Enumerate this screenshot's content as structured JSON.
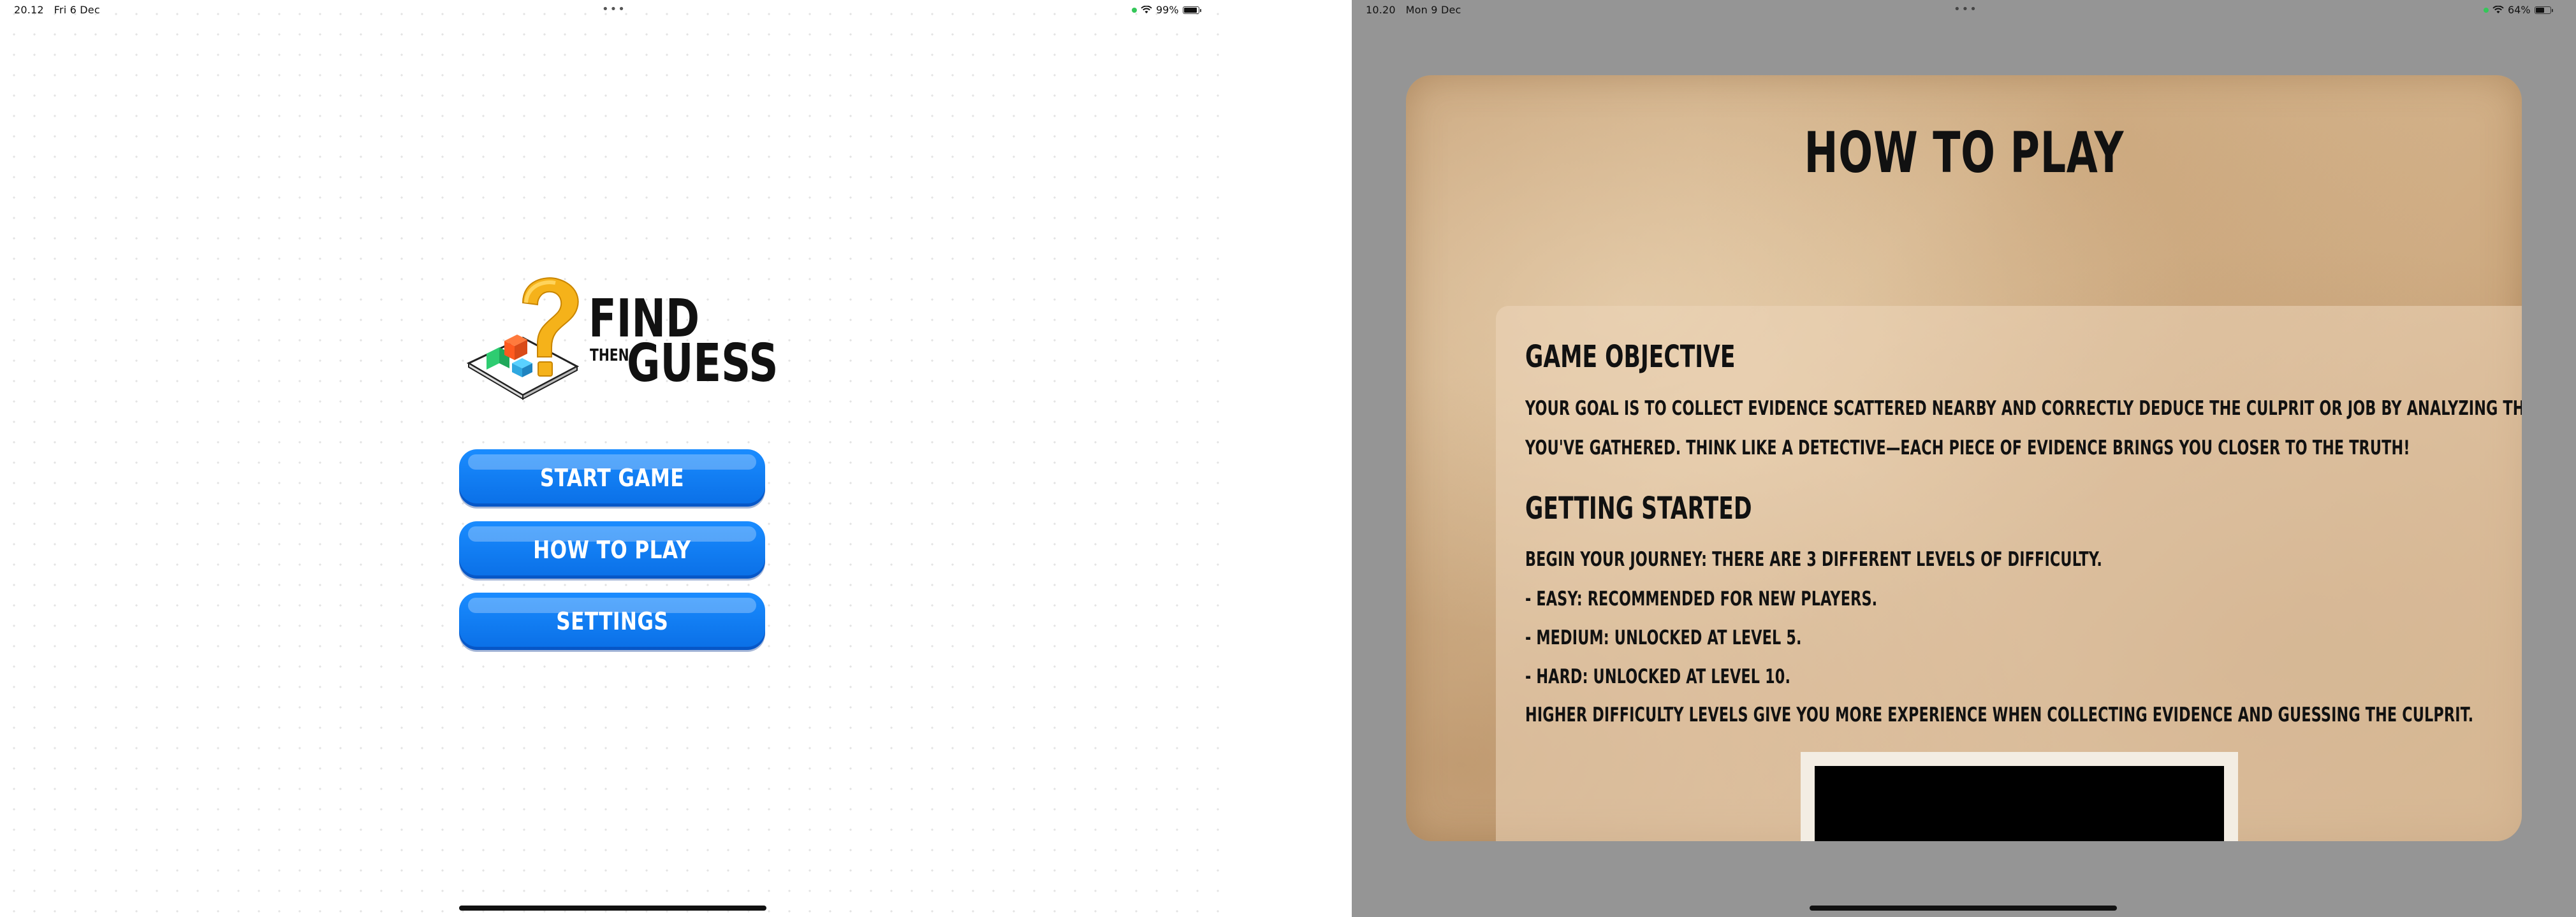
{
  "left_screen": {
    "status_bar": {
      "time": "20.12",
      "date": "Fri 6 Dec",
      "dots": "•••",
      "battery": "99%",
      "battery_level": 0.99
    },
    "logo": {
      "line1": "FIND",
      "line2": "THEN",
      "line3": "GUESS"
    },
    "menu": {
      "start_label": "START GAME",
      "how_to_play_label": "HOW TO PLAY",
      "settings_label": "SETTINGS"
    }
  },
  "right_screen": {
    "status_bar": {
      "time": "10.20",
      "date": "Mon 9 Dec",
      "dots": "•••",
      "battery": "64%",
      "battery_level": 0.64
    },
    "modal": {
      "title": "HOW TO PLAY",
      "close_icon": "close-icon",
      "sections": {
        "objective_heading": "GAME OBJECTIVE",
        "objective_line1": "YOUR GOAL IS TO COLLECT EVIDENCE SCATTERED NEARBY AND CORRECTLY DEDUCE THE CULPRIT OR JOB BY ANALYZING THE ITEMS",
        "objective_line2": "YOU'VE GATHERED. THINK LIKE A DETECTIVE—EACH PIECE OF EVIDENCE BRINGS YOU CLOSER TO THE TRUTH!",
        "started_heading": "GETTING STARTED",
        "started_line1": "BEGIN YOUR JOURNEY: THERE ARE 3 DIFFERENT LEVELS OF DIFFICULTY.",
        "started_line2": "- EASY: RECOMMENDED FOR NEW PLAYERS.",
        "started_line3": "- MEDIUM: UNLOCKED AT LEVEL 5.",
        "started_line4": "- HARD: UNLOCKED AT LEVEL 10.",
        "started_line5": "HIGHER DIFFICULTY LEVELS GIVE YOU MORE EXPERIENCE WHEN COLLECTING EVIDENCE AND GUESSING THE CULPRIT."
      }
    }
  },
  "colors": {
    "button_blue": "#0a7ff5",
    "close_red": "#e0312c",
    "paper": "#d4b38a",
    "logo_gold": "#f5b21a"
  }
}
